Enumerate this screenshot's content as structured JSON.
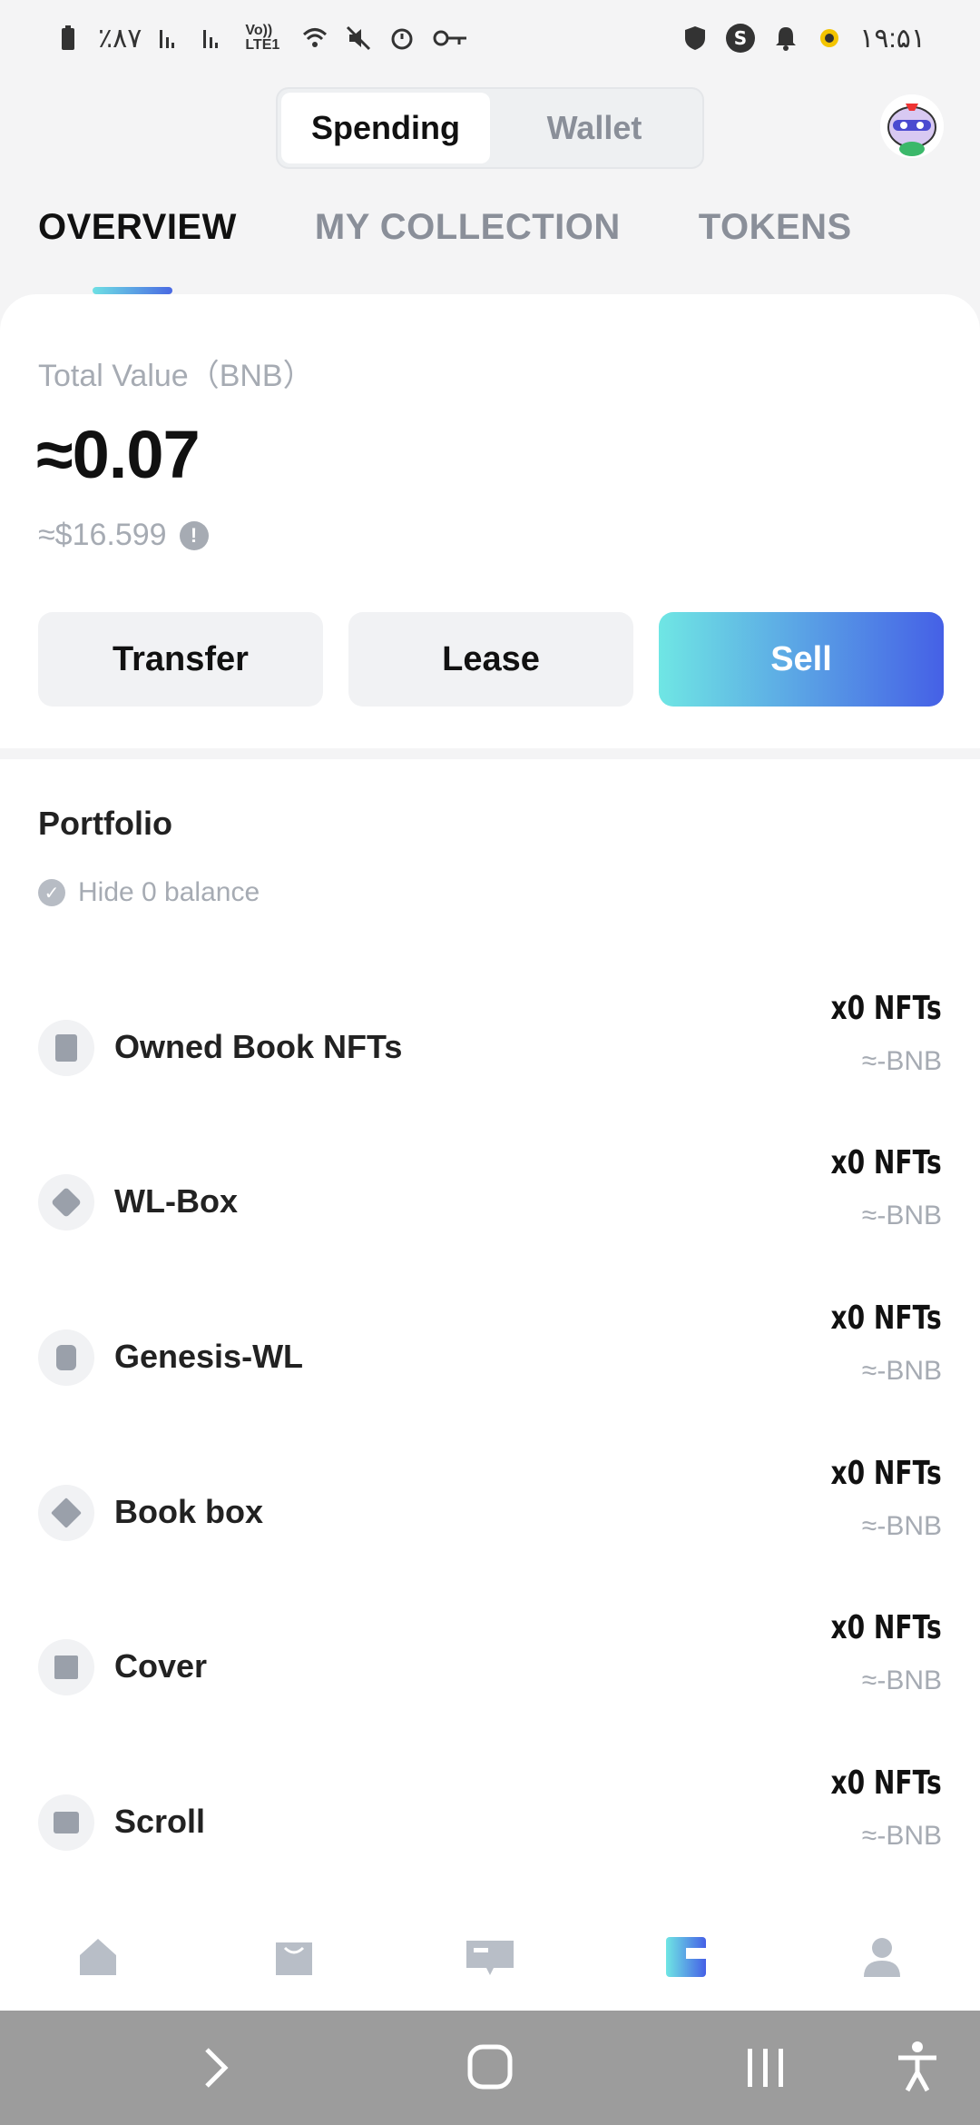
{
  "status_bar": {
    "battery_text": "٪۸۷",
    "network_label": "Vo)) LTE1",
    "time": "۱۹:۵۱"
  },
  "header": {
    "segments": [
      "Spending",
      "Wallet"
    ],
    "active_segment": "Spending",
    "avatar_icon": "avatar-image"
  },
  "tabs": [
    {
      "label": "OVERVIEW",
      "active": true
    },
    {
      "label": "MY COLLECTION",
      "active": false
    },
    {
      "label": "TOKENS",
      "active": false
    }
  ],
  "summary": {
    "total_label": "Total Value（BNB）",
    "total_value": "≈0.07",
    "usd_value": "≈$16.599",
    "info_icon": "!"
  },
  "actions": {
    "transfer": "Transfer",
    "lease": "Lease",
    "sell": "Sell"
  },
  "portfolio": {
    "title": "Portfolio",
    "hide_zero_label": "Hide 0 balance",
    "check_glyph": "✓",
    "items": [
      {
        "name": "Owned Book NFTs",
        "qty": "x0 NFTs",
        "value": "≈-BNB",
        "icon": "book-icon"
      },
      {
        "name": "WL-Box",
        "qty": "x0 NFTs",
        "value": "≈-BNB",
        "icon": "wl-box-icon"
      },
      {
        "name": "Genesis-WL",
        "qty": "x0 NFTs",
        "value": "≈-BNB",
        "icon": "genesis-icon"
      },
      {
        "name": "Book box",
        "qty": "x0 NFTs",
        "value": "≈-BNB",
        "icon": "box-icon"
      },
      {
        "name": "Cover",
        "qty": "x0 NFTs",
        "value": "≈-BNB",
        "icon": "cover-icon"
      },
      {
        "name": "Scroll",
        "qty": "x0 NFTs",
        "value": "≈-BNB",
        "icon": "scroll-icon"
      }
    ]
  },
  "bottom_nav": [
    {
      "icon": "home-icon",
      "active": false
    },
    {
      "icon": "store-icon",
      "active": false
    },
    {
      "icon": "message-icon",
      "active": false
    },
    {
      "icon": "wallet-icon",
      "active": true
    },
    {
      "icon": "profile-icon",
      "active": false
    }
  ],
  "colors": {
    "accent_start": "#6fe6e4",
    "accent_end": "#4560e6",
    "muted_text": "#a6abb3"
  }
}
